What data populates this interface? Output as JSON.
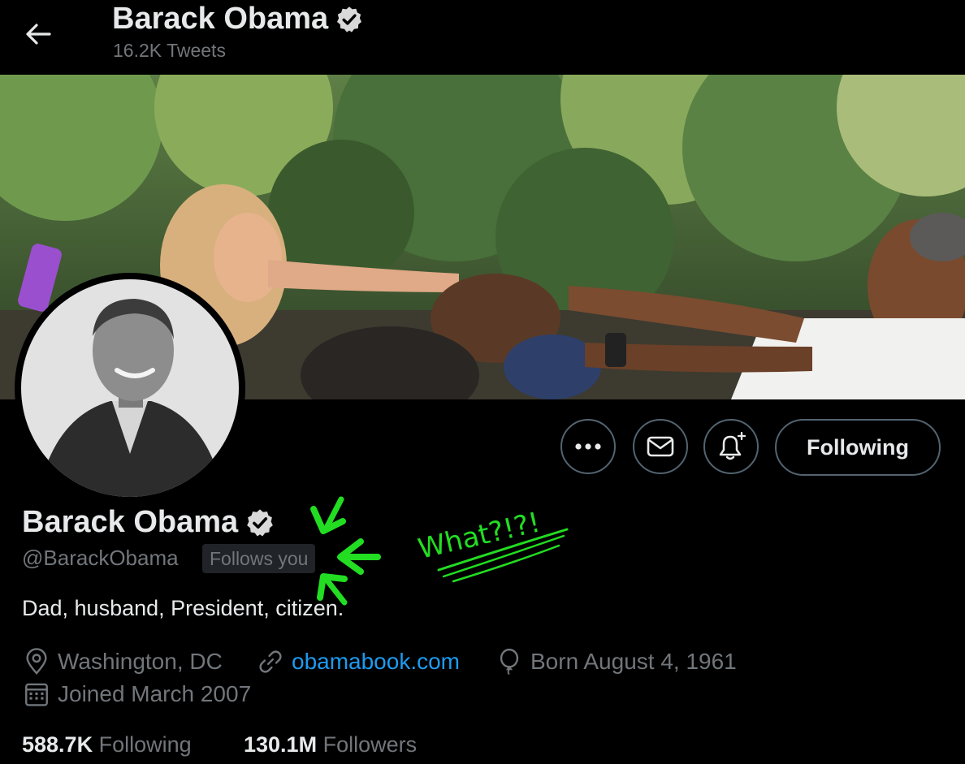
{
  "header": {
    "title": "Barack Obama",
    "tweet_count": "16.2K Tweets"
  },
  "icons": {
    "back": "arrow-left-icon",
    "verified": "verified-badge-icon",
    "more": "more-icon",
    "message": "envelope-icon",
    "notify": "bell-plus-icon",
    "location": "location-pin-icon",
    "link": "link-icon",
    "birthday": "balloon-icon",
    "joined": "calendar-icon"
  },
  "profile": {
    "name": "Barack Obama",
    "handle": "@BarackObama",
    "follows_badge": "Follows you",
    "bio": "Dad, husband, President, citizen.",
    "location": "Washington, DC",
    "website": "obamabook.com",
    "birthday": "Born August 4, 1961",
    "joined": "Joined March 2007",
    "following_count": "588.7K",
    "following_label": "Following",
    "followers_count": "130.1M",
    "followers_label": "Followers"
  },
  "actions": {
    "following_button": "Following"
  },
  "annotation": {
    "text": "What?!?!",
    "color": "#22dd22"
  },
  "colors": {
    "background": "#000000",
    "text_primary": "#e7e9ea",
    "text_secondary": "#71767b",
    "link": "#1d9bf0",
    "border": "#536471"
  }
}
